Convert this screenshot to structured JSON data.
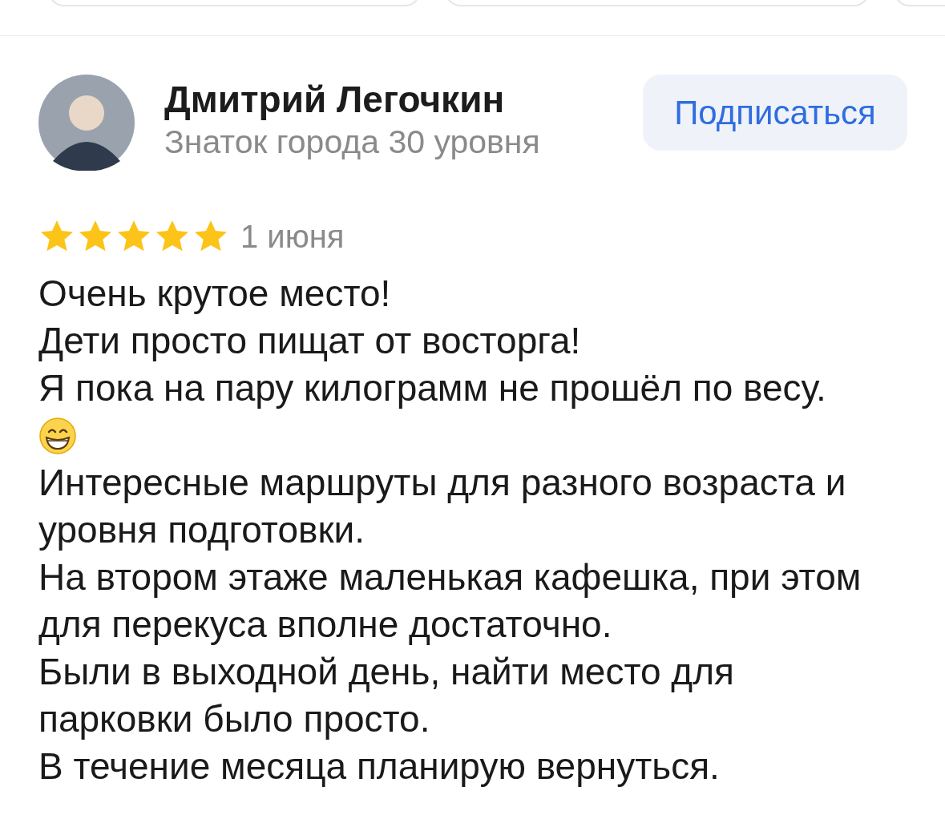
{
  "author": {
    "name": "Дмитрий Легочкин",
    "subtitle": "Знаток города 30 уровня"
  },
  "subscribe_button": "Подписаться",
  "review": {
    "stars": 5,
    "date": "1 июня",
    "lines": [
      {
        "kind": "text",
        "text": "Очень крутое место!"
      },
      {
        "kind": "text",
        "text": "Дети просто пищат от восторга!"
      },
      {
        "kind": "text",
        "text": "Я пока на пару килограмм не прошёл по весу."
      },
      {
        "kind": "emoji"
      },
      {
        "kind": "text",
        "text": "Интересные маршруты для разного возраста и"
      },
      {
        "kind": "text",
        "text": "уровня подготовки."
      },
      {
        "kind": "text",
        "text": "На втором этаже маленькая кафешка, при этом"
      },
      {
        "kind": "text",
        "text": "для перекуса вполне достаточно."
      },
      {
        "kind": "text",
        "text": "Были в выходной день, найти место для"
      },
      {
        "kind": "text",
        "text": "парковки было просто."
      },
      {
        "kind": "text",
        "text": "В течение месяца планирую вернуться."
      }
    ]
  }
}
